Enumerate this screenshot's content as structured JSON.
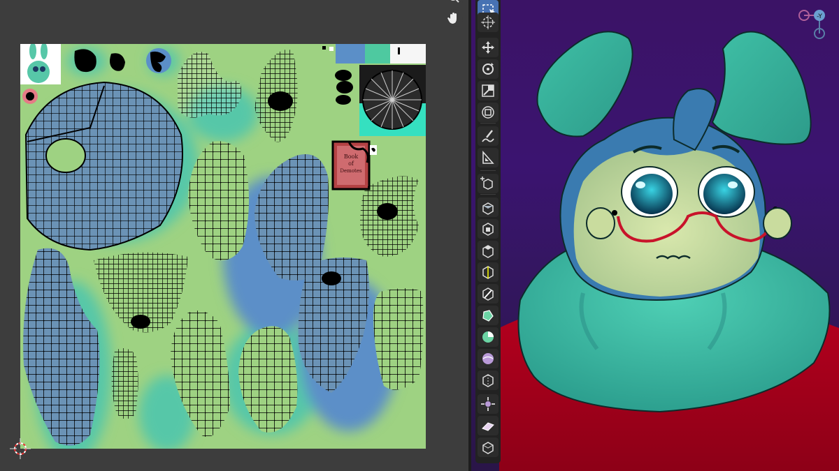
{
  "uv_editor": {
    "texture_label": {
      "line1": "Book",
      "line2": "of",
      "line3": "Demotes"
    },
    "nav_icons": [
      "zoom-icon",
      "hand-pan-icon"
    ],
    "cursor": "2d-cursor-icon"
  },
  "viewport": {
    "gizmo": {
      "axis_label": "-Y"
    },
    "toolbar": {
      "tools": [
        {
          "name": "select-box-tool",
          "icon": "select-box-icon",
          "active": true
        },
        {
          "name": "cursor-tool",
          "icon": "cursor-icon",
          "active": false
        },
        {
          "name": "move-tool",
          "icon": "move-icon",
          "active": false
        },
        {
          "name": "rotate-tool",
          "icon": "rotate-icon",
          "active": false
        },
        {
          "name": "scale-tool",
          "icon": "scale-icon",
          "active": false
        },
        {
          "name": "transform-tool",
          "icon": "transform-icon",
          "active": false
        },
        {
          "name": "annotate-tool",
          "icon": "annotate-icon",
          "active": false
        },
        {
          "name": "measure-tool",
          "icon": "measure-icon",
          "active": false
        },
        {
          "name": "add-cube-tool",
          "icon": "add-cube-icon",
          "active": false
        },
        {
          "name": "extrude-region-tool",
          "icon": "extrude-icon",
          "active": false
        },
        {
          "name": "inset-faces-tool",
          "icon": "inset-icon",
          "active": false
        },
        {
          "name": "bevel-tool",
          "icon": "bevel-icon",
          "active": false
        },
        {
          "name": "loop-cut-tool",
          "icon": "loop-cut-icon",
          "active": false
        },
        {
          "name": "knife-tool",
          "icon": "knife-icon",
          "active": false
        },
        {
          "name": "poly-build-tool",
          "icon": "poly-build-icon",
          "active": false
        },
        {
          "name": "spin-tool",
          "icon": "spin-icon",
          "active": false
        },
        {
          "name": "smooth-tool",
          "icon": "smooth-icon",
          "active": false
        },
        {
          "name": "edge-slide-tool",
          "icon": "edge-slide-icon",
          "active": false
        },
        {
          "name": "shrink-fatten-tool",
          "icon": "shrink-fatten-icon",
          "active": false
        },
        {
          "name": "shear-tool",
          "icon": "shear-icon",
          "active": false
        },
        {
          "name": "rip-region-tool",
          "icon": "rip-icon",
          "active": false
        }
      ]
    }
  },
  "colors": {
    "uv_background": "#9ed282",
    "uv_island_fill": "#6b93b6",
    "uv_glow": "#57c7a8",
    "uv_grid": "#000000",
    "viewport_bg": "#3b1366",
    "character_teal": "#3ebfa6",
    "character_face": "#c9dc9e",
    "shirt_red": "#a3001d",
    "glasses_red": "#c8132a",
    "toolbar_bg": "#222222",
    "active_tool": "#4772b3"
  }
}
